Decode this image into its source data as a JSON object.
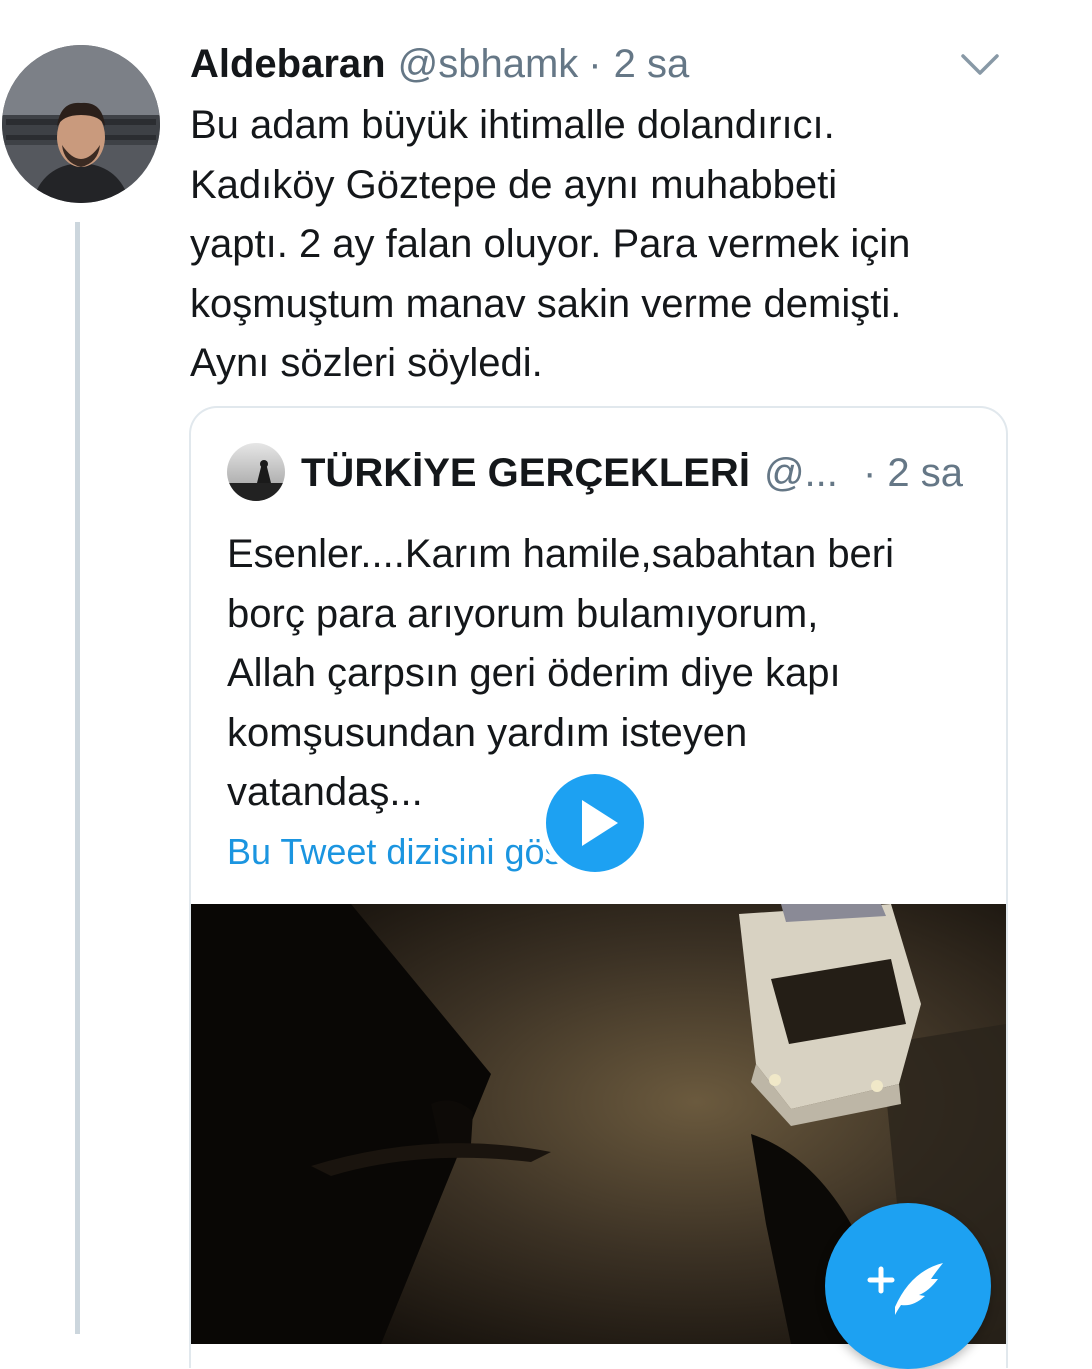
{
  "tweet": {
    "author_name": "Aldebaran",
    "author_handle": "@sbhamk",
    "separator": "·",
    "time": "2 sa",
    "text_lines": [
      "Bu adam büyük ihtimalle dolandırıcı.",
      "Kadıköy Göztepe de aynı muhabbeti",
      "yaptı. 2 ay falan oluyor. Para vermek için",
      "koşmuştum manav sakin verme demişti.",
      "Aynı sözleri söyledi."
    ]
  },
  "quoted_tweet": {
    "author_name": "TÜRKİYE GERÇEKLERİ",
    "author_handle": "@...",
    "time_display": "· 2 sa",
    "text_lines": [
      "Esenler....Karım hamile,sabahtan beri",
      "borç para arıyorum bulamıyorum,",
      "Allah çarpsın geri öderim diye kapı",
      "komşusundan yardım isteyen",
      "vatandaş..."
    ],
    "thread_link": "Bu Tweet dizisini göster"
  },
  "icons": {
    "more_menu": "chevron-down-icon",
    "play": "play-icon",
    "compose": "compose-tweet-icon"
  },
  "colors": {
    "link_blue": "#1b95e0",
    "fab_blue": "#1da1f2",
    "secondary_text": "#657786",
    "border": "#e1e8ed"
  }
}
